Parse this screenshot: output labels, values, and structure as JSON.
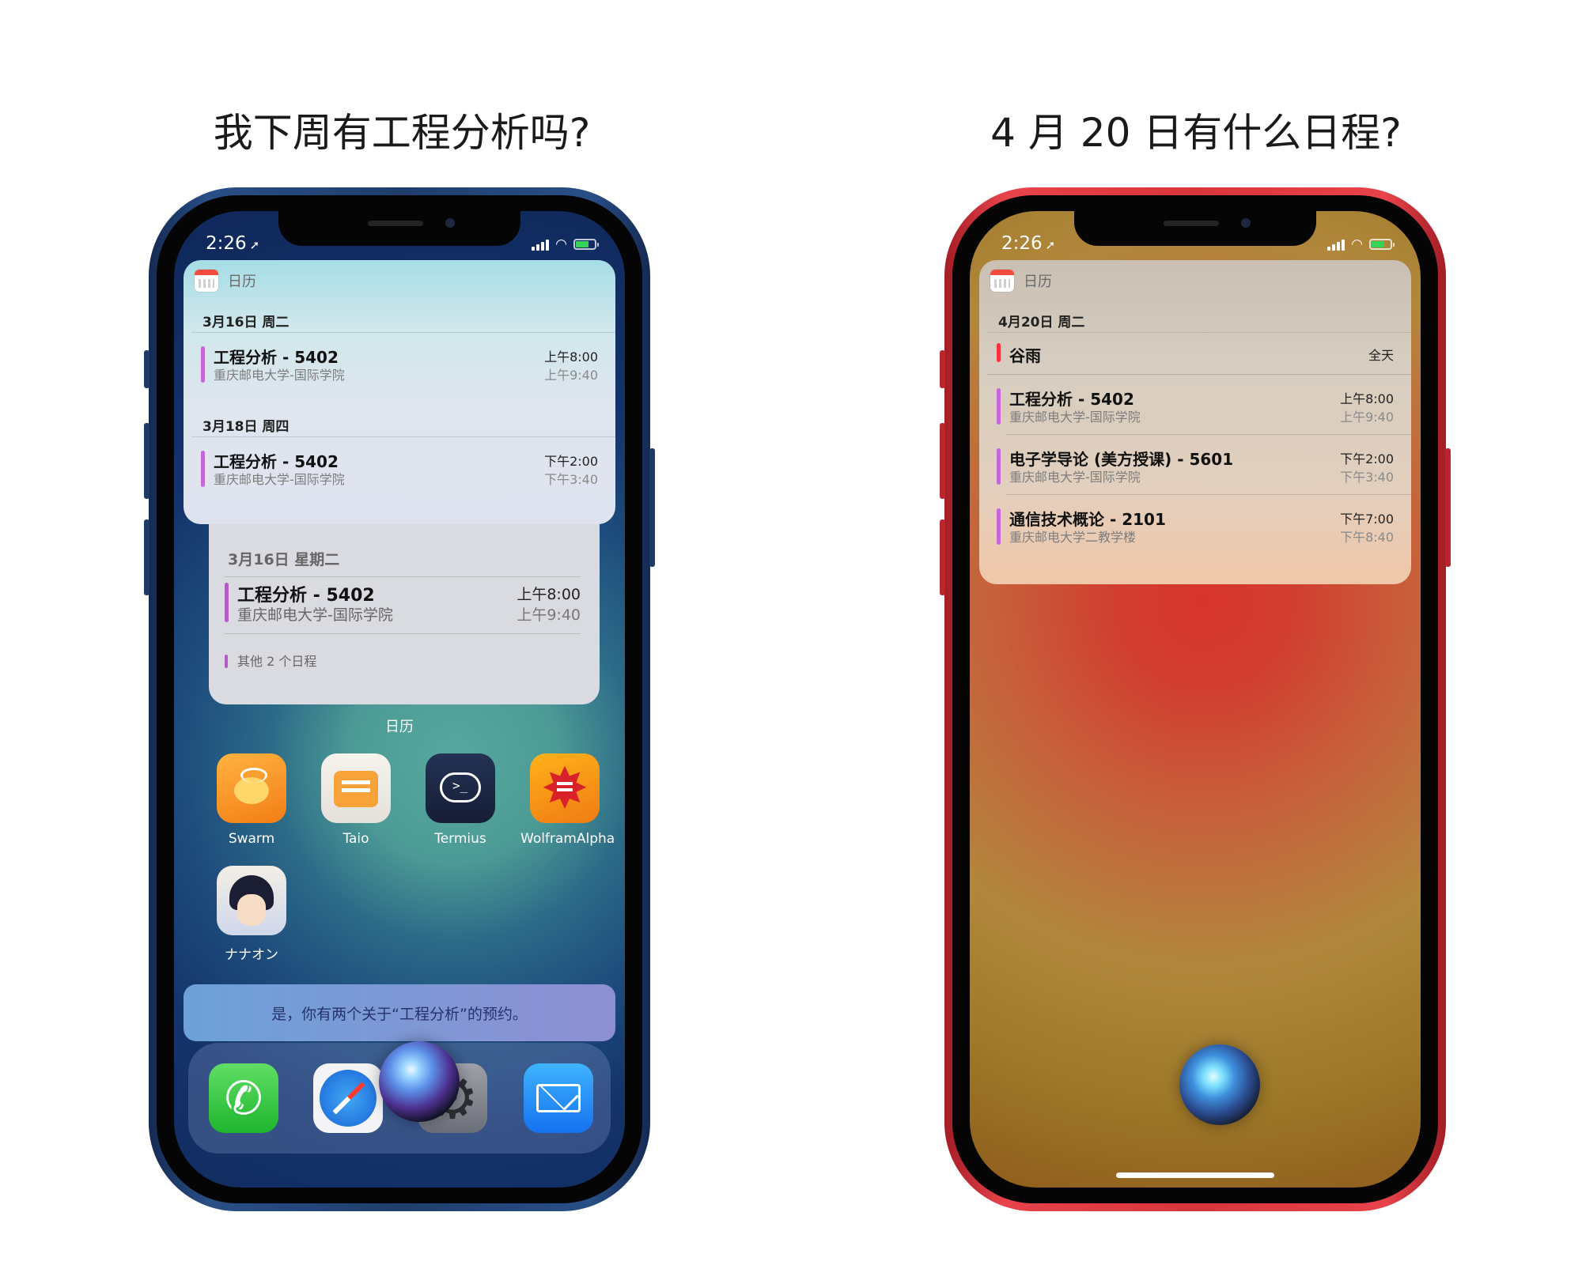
{
  "captions": {
    "left": "我下周有工程分析吗?",
    "right": "4 月 20 日有什么日程?"
  },
  "left_phone": {
    "status_time": "2:26",
    "widget": {
      "app_name": "日历",
      "days": [
        {
          "date": "3月16日 周二",
          "events": [
            {
              "title": "工程分析 - 5402",
              "location": "重庆邮电大学-国际学院",
              "start": "上午8:00",
              "end": "上午9:40"
            }
          ]
        },
        {
          "date": "3月18日 周四",
          "events": [
            {
              "title": "工程分析 - 5402",
              "location": "重庆邮电大学-国际学院",
              "start": "下午2:00",
              "end": "下午3:40"
            }
          ]
        }
      ]
    },
    "home_widget": {
      "date": "3月16日 星期二",
      "event": {
        "title": "工程分析 - 5402",
        "location": "重庆邮电大学-国际学院",
        "start": "上午8:00",
        "end": "上午9:40"
      },
      "more": "其他 2 个日程",
      "label": "日历"
    },
    "apps": [
      {
        "label": "Swarm",
        "icon": "swarm-icon"
      },
      {
        "label": "Taio",
        "icon": "taio-icon"
      },
      {
        "label": "Termius",
        "icon": "termius-icon"
      },
      {
        "label": "WolframAlpha",
        "icon": "wolfram-icon"
      },
      {
        "label": "ナナオン",
        "icon": "nanaon-icon"
      }
    ],
    "siri_response": "是，你有两个关于“工程分析”的预约。",
    "dock": [
      "phone-icon",
      "safari-icon",
      "settings-icon",
      "mail-icon"
    ]
  },
  "right_phone": {
    "status_time": "2:26",
    "widget": {
      "app_name": "日历",
      "date": "4月20日 周二",
      "all_day": {
        "title": "谷雨",
        "time": "全天"
      },
      "events": [
        {
          "title": "工程分析 - 5402",
          "location": "重庆邮电大学-国际学院",
          "start": "上午8:00",
          "end": "上午9:40"
        },
        {
          "title": "电子学导论 (美方授课) - 5601",
          "location": "重庆邮电大学-国际学院",
          "start": "下午2:00",
          "end": "下午3:40"
        },
        {
          "title": "通信技术概论 - 2101",
          "location": "重庆邮电大学二教学楼",
          "start": "下午7:00",
          "end": "下午8:40"
        }
      ]
    }
  }
}
